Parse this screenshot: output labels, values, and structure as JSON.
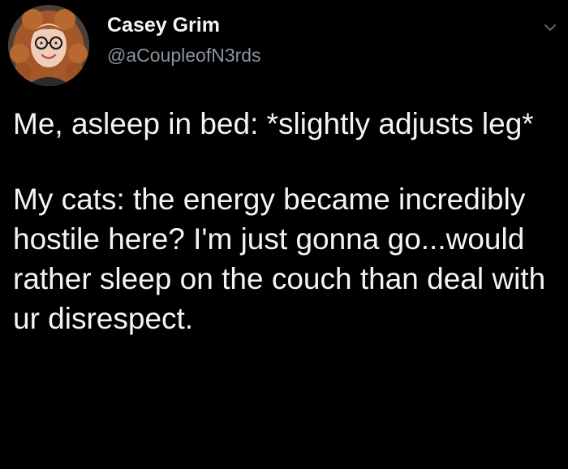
{
  "tweet": {
    "author": {
      "display_name": "Casey Grim",
      "handle": "@aCoupleofN3rds"
    },
    "body": {
      "paragraph_1": "Me, asleep in bed: *slightly adjusts leg*",
      "paragraph_2": "My cats: the energy became incredibly hostile here? I'm just gonna go...would rather sleep on the couch than deal with ur disrespect."
    },
    "icons": {
      "avatar": "profile-photo",
      "menu": "chevron-down-icon"
    }
  },
  "colors": {
    "background": "#000000",
    "text": "#f4f4f4",
    "handle": "#8b949c"
  }
}
